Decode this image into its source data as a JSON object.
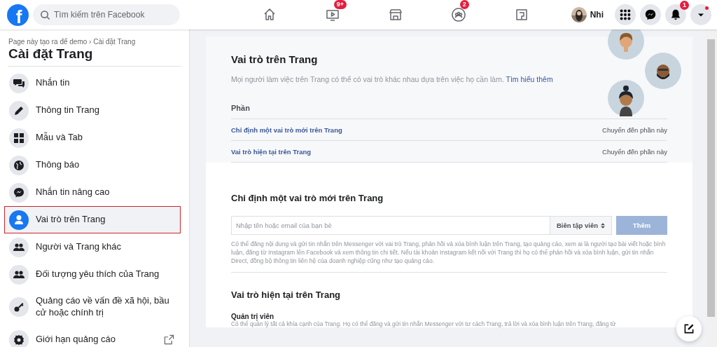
{
  "logo": "f",
  "search": {
    "placeholder": "Tìm kiếm trên Facebook"
  },
  "nav_tabs": [
    {
      "kind": "home"
    },
    {
      "kind": "video",
      "badge": "9+"
    },
    {
      "kind": "marketplace"
    },
    {
      "kind": "groups",
      "badge": "2"
    },
    {
      "kind": "gaming"
    }
  ],
  "profile": {
    "name": "Nhi"
  },
  "actions": [
    {
      "kind": "menu",
      "dot": false
    },
    {
      "kind": "messenger",
      "dot": false
    },
    {
      "kind": "notifications",
      "badge": "1",
      "dot": false
    },
    {
      "kind": "account",
      "dot": true
    }
  ],
  "sidebar": {
    "breadcrumb": "Page này tạo ra để demo › Cài đặt Trang",
    "title": "Cài đặt Trang",
    "items": [
      {
        "kind": "chat",
        "label": "Nhắn tin",
        "selected": false,
        "external": false
      },
      {
        "kind": "pencil",
        "label": "Thông tin Trang",
        "selected": false,
        "external": false
      },
      {
        "kind": "grid",
        "label": "Mẫu và Tab",
        "selected": false,
        "external": false
      },
      {
        "kind": "globe",
        "label": "Thông báo",
        "selected": false,
        "external": false
      },
      {
        "kind": "messenger",
        "label": "Nhắn tin nâng cao",
        "selected": false,
        "external": false
      },
      {
        "kind": "person",
        "label": "Vai trò trên Trang",
        "selected": true,
        "external": false
      },
      {
        "kind": "people",
        "label": "Người và Trang khác",
        "selected": false,
        "external": false
      },
      {
        "kind": "people",
        "label": "Đối tượng yêu thích của Trang",
        "selected": false,
        "external": false
      },
      {
        "kind": "key",
        "label": "Quảng cáo về vấn đề xã hội, bầu cử hoặc chính trị",
        "selected": false,
        "external": false
      },
      {
        "kind": "gear",
        "label": "Giới hạn quảng cáo",
        "selected": false,
        "external": true
      }
    ]
  },
  "roles_intro": {
    "title": "Vai trò trên Trang",
    "description": "Mọi người làm việc trên Trang có thể có vai trò khác nhau dựa trên việc họ cần làm.",
    "link": "Tìm hiểu thêm",
    "section_heading": "Phần",
    "sections": [
      {
        "label": "Chỉ định một vai trò mới trên Trang",
        "action": "Chuyển đến phần này"
      },
      {
        "label": "Vai trò hiện tại trên Trang",
        "action": "Chuyển đến phần này"
      }
    ]
  },
  "assign": {
    "title": "Chỉ định một vai trò mới trên Trang",
    "placeholder": "Nhập tên hoặc email của bạn bè",
    "role": "Biên tập viên",
    "button": "Thêm",
    "button_disabled": true,
    "help": "Có thể đăng nội dung và gửi tin nhắn trên Messenger với vai trò Trang, phản hồi và xóa bình luận trên Trang, tạo quảng cáo, xem ai là người tạo bài viết hoặc bình luận, đăng từ Instagram lên Facebook và xem thông tin chi tiết. Nếu tài khoản Instagram kết nối với Trang thì họ có thể phản hồi và xóa bình luận, gửi tin nhắn Direct, đồng bộ thông tin liên hệ của doanh nghiệp cũng như tạo quảng cáo."
  },
  "current": {
    "title": "Vai trò hiện tại trên Trang",
    "roles": [
      {
        "name": "Quản trị viên",
        "description": "Có thể quản lý tất cả khía cạnh của Trang. Họ có thể đăng và gửi tin nhắn Messenger với tư cách Trang, trả lời và xóa bình luận trên Trang, đăng từ"
      }
    ]
  }
}
